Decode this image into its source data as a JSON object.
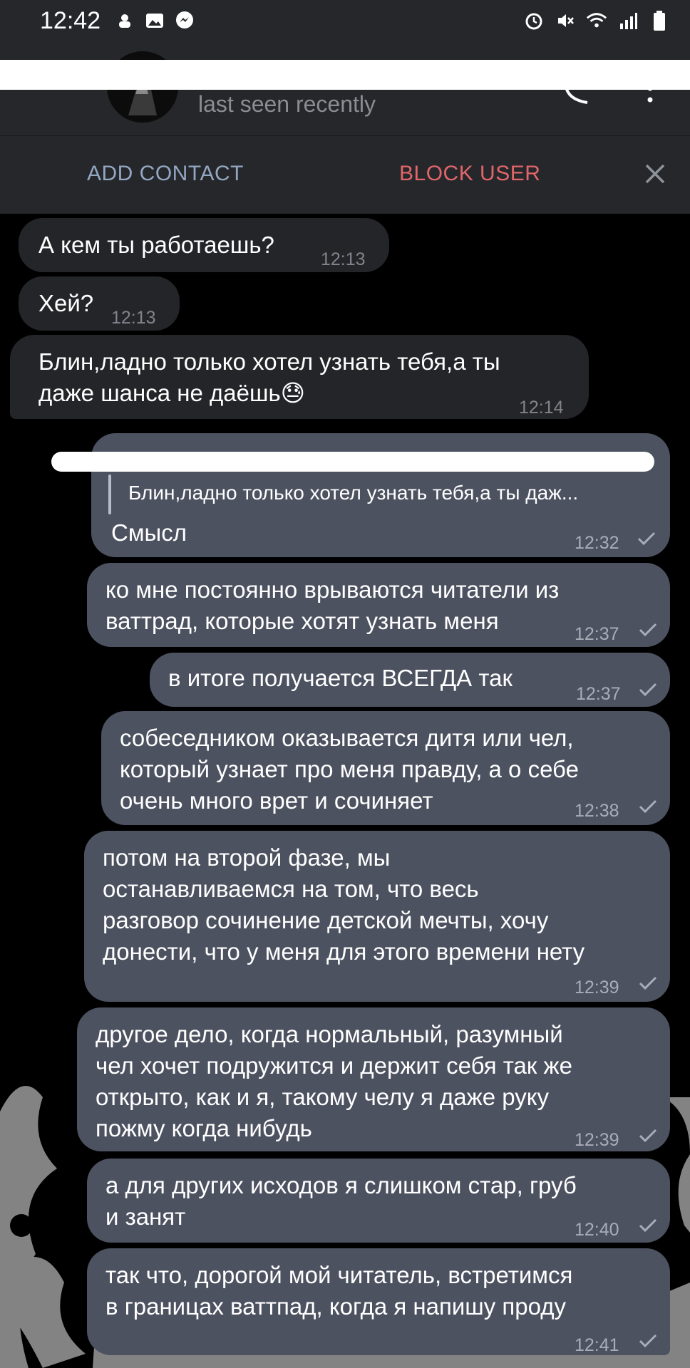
{
  "status_bar": {
    "time": "12:42"
  },
  "header": {
    "last_seen": "last seen recently"
  },
  "action_bar": {
    "add_contact": "ADD CONTACT",
    "block_user": "BLOCK USER"
  },
  "messages": [
    {
      "text": "А кем ты работаешь?",
      "time": "12:13",
      "type": "in"
    },
    {
      "text": "Хей?",
      "time": "12:13",
      "type": "in"
    },
    {
      "text": "Блин,ладно только хотел узнать тебя,а ты\nдаже шанса не даёшь😓",
      "time": "12:14",
      "type": "in"
    },
    {
      "reply_preview": "Блин,ладно только хотел узнать тебя,а ты даж...",
      "text": "Смысл",
      "time": "12:32",
      "type": "out"
    },
    {
      "text": "ко мне постоянно врываются читатели из\nваттрад, которые хотят узнать меня",
      "time": "12:37",
      "type": "out"
    },
    {
      "text": "в итоге получается ВСЕГДА так",
      "time": "12:37",
      "type": "out"
    },
    {
      "text": "собеседником оказывается дитя или чел,\nкоторый узнает про меня правду, а о себе\nочень много врет и сочиняет",
      "time": "12:38",
      "type": "out"
    },
    {
      "text": "потом на второй фазе, мы\nостанавливаемся на том, что весь\nразговор сочинение детской мечты, хочу\nдонести, что у меня для этого времени нету",
      "time": "12:39",
      "type": "out"
    },
    {
      "text": "другое дело, когда нормальный, разумный\nчел хочет подружится и держит себя так же\nоткрыто, как и я, такому челу я даже руку\nпожму когда нибудь",
      "time": "12:39",
      "type": "out"
    },
    {
      "text": "а для других исходов я слишком стар, груб\nи занят",
      "time": "12:40",
      "type": "out"
    },
    {
      "text": "так что, дорогой мой читатель, встретимся\nв границах ваттпад, когда я напишу проду",
      "time": "12:41",
      "type": "out"
    }
  ]
}
